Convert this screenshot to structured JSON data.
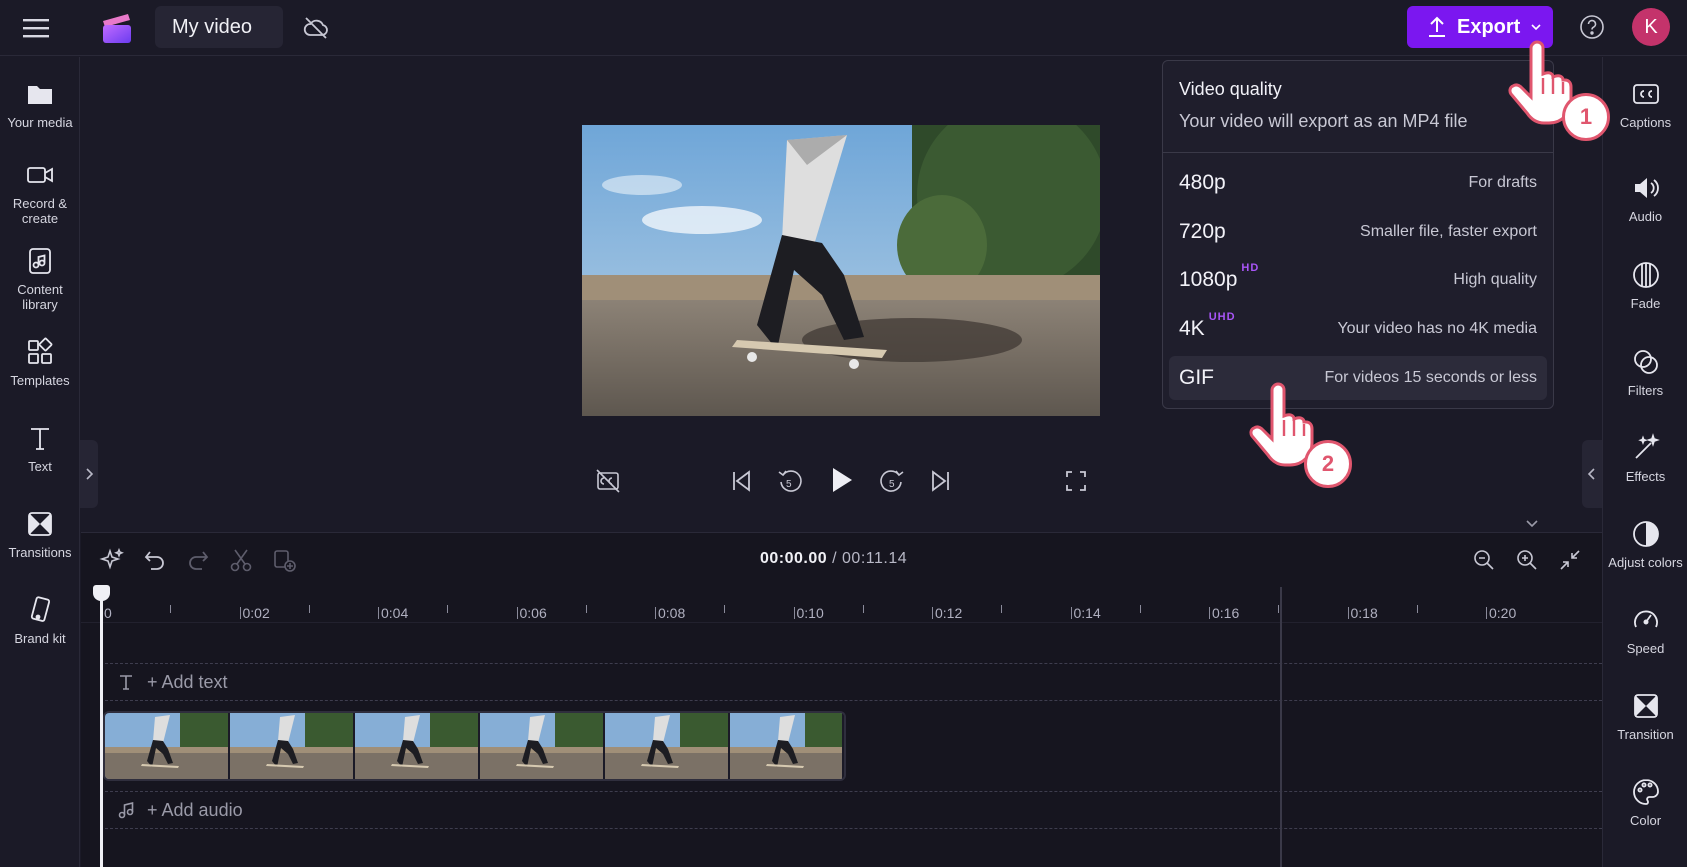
{
  "header": {
    "project_title": "My video",
    "export_label": "Export",
    "avatar_initial": "K"
  },
  "left_sidebar": {
    "items": [
      {
        "label": "Your media",
        "icon": "folder-icon"
      },
      {
        "label": "Record & create",
        "icon": "camera-icon"
      },
      {
        "label": "Content library",
        "icon": "content-library-icon"
      },
      {
        "label": "Templates",
        "icon": "templates-icon"
      },
      {
        "label": "Text",
        "icon": "text-icon"
      },
      {
        "label": "Transitions",
        "icon": "transitions-icon"
      },
      {
        "label": "Brand kit",
        "icon": "brand-kit-icon"
      }
    ]
  },
  "right_sidebar": {
    "items": [
      {
        "label": "Captions",
        "icon": "captions-icon"
      },
      {
        "label": "Audio",
        "icon": "audio-icon"
      },
      {
        "label": "Fade",
        "icon": "fade-icon"
      },
      {
        "label": "Filters",
        "icon": "filters-icon"
      },
      {
        "label": "Effects",
        "icon": "effects-icon"
      },
      {
        "label": "Adjust colors",
        "icon": "adjust-colors-icon"
      },
      {
        "label": "Speed",
        "icon": "speed-icon"
      },
      {
        "label": "Transition",
        "icon": "transition-icon"
      },
      {
        "label": "Color",
        "icon": "color-icon"
      }
    ]
  },
  "export_menu": {
    "title": "Video quality",
    "subtitle": "Your video will export as an MP4 file",
    "options": [
      {
        "label": "480p",
        "badge": "",
        "desc": "For drafts"
      },
      {
        "label": "720p",
        "badge": "",
        "desc": "Smaller file, faster export"
      },
      {
        "label": "1080p",
        "badge": "HD",
        "desc": "High quality"
      },
      {
        "label": "4K",
        "badge": "UHD",
        "desc": "Your video has no 4K media"
      },
      {
        "label": "GIF",
        "badge": "",
        "desc": "For videos 15 seconds or less"
      }
    ],
    "hovered_option": "GIF"
  },
  "callouts": {
    "step1": "1",
    "step2": "2"
  },
  "timeline": {
    "current_time": "00:00.00",
    "total_time": "/ 00:11.14",
    "ruler_labels": [
      "0",
      "0:02",
      "0:04",
      "0:06",
      "0:08",
      "0:10",
      "0:12",
      "0:14",
      "0:16",
      "0:18",
      "0:20"
    ],
    "add_text_label": "+ Add text",
    "add_audio_label": "+ Add audio",
    "clip_thumbnail_count": 6
  },
  "colors": {
    "accent": "#7b17f0",
    "badge": "#a855f7",
    "avatar": "#c4336b",
    "callout_ring": "#e0566e"
  }
}
